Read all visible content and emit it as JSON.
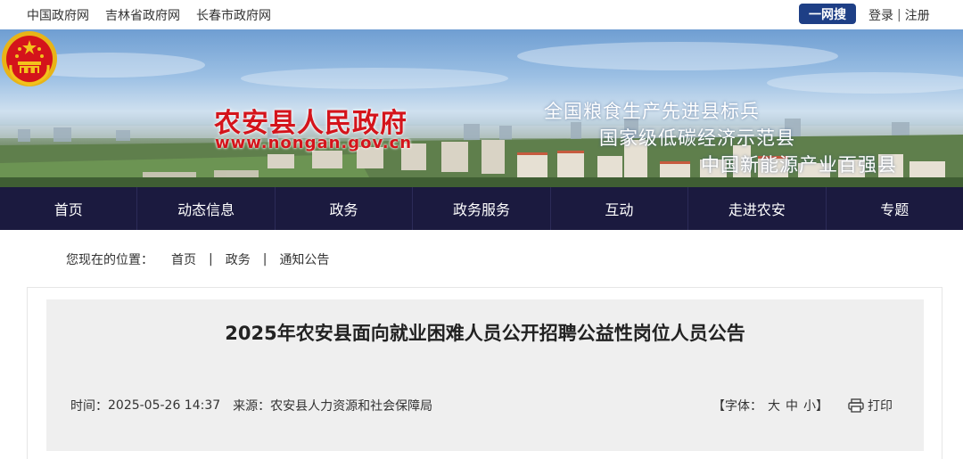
{
  "topbar": {
    "links": [
      "中国政府网",
      "吉林省政府网",
      "长春市政府网"
    ],
    "search_label": "一网搜",
    "login_label": "登录",
    "divider": "|",
    "register_label": "注册"
  },
  "banner": {
    "site_name": "农安县人民政府",
    "site_url": "www.nongan.gov.cn",
    "slogans": [
      "全国粮食生产先进县标兵",
      "国家级低碳经济示范县",
      "中国新能源产业百强县"
    ]
  },
  "nav": {
    "items": [
      "首页",
      "动态信息",
      "政务",
      "政务服务",
      "互动",
      "走进农安",
      "专题"
    ]
  },
  "breadcrumb": {
    "lead": "您现在的位置：",
    "items": [
      "首页",
      "政务",
      "通知公告"
    ],
    "separator": "|"
  },
  "article": {
    "title": "2025年农安县面向就业困难人员公开招聘公益性岗位人员公告",
    "time_label": "时间：",
    "time_value": "2025-05-26 14:37",
    "source_label": "来源：",
    "source_value": "农安县人力资源和社会保障局",
    "font_label": "【字体：",
    "font_large": "大",
    "font_medium": "中",
    "font_small": "小",
    "font_close": "】",
    "print_label": "打印"
  },
  "colors": {
    "nav_bg": "#1b1a3f",
    "search_bg": "#1e3f86",
    "brand_red": "#d4141b"
  }
}
